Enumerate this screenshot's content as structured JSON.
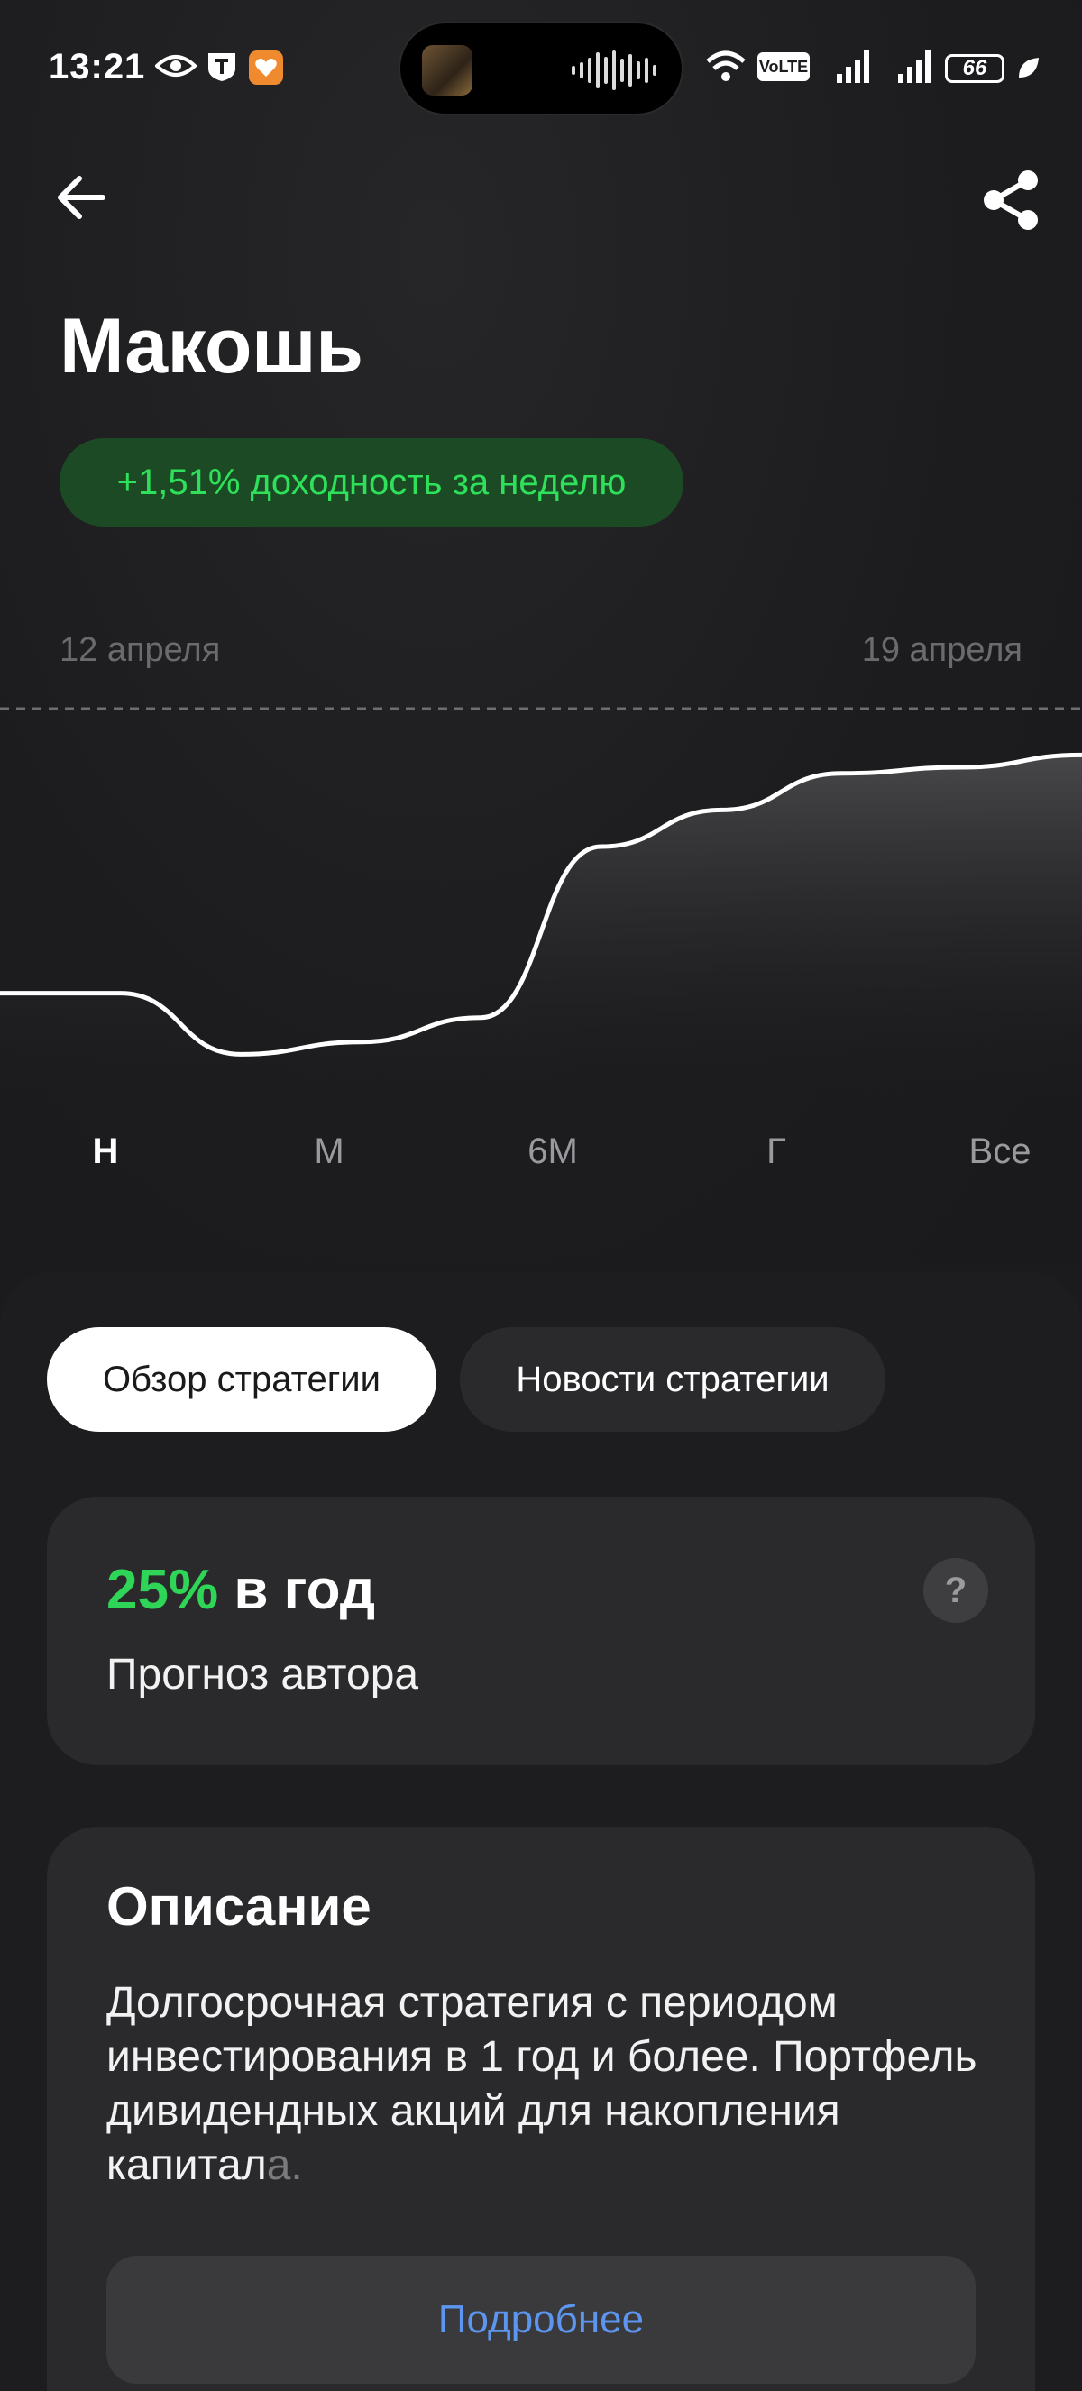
{
  "status_bar": {
    "time": "13:21",
    "battery": "66"
  },
  "header": {
    "title": "Макошь",
    "yield_badge": "+1,51% доходность за неделю"
  },
  "chart_data": {
    "type": "area",
    "x_labels": [
      "12 апреля",
      "19 апреля"
    ],
    "values": [
      0.0,
      0.0,
      -0.5,
      -0.4,
      -0.2,
      1.2,
      1.5,
      1.8,
      1.85,
      1.95
    ],
    "ylim": [
      -0.8,
      2.3
    ],
    "reference_line": "dashed",
    "grid": false
  },
  "periods": [
    "Н",
    "М",
    "6М",
    "Г",
    "Все"
  ],
  "active_period": "Н",
  "tabs": {
    "overview": "Обзор стратегии",
    "news": "Новости стратегии"
  },
  "forecast": {
    "value": "25%",
    "unit": " в год",
    "label": "Прогноз автора",
    "help": "?"
  },
  "description": {
    "title": "Описание",
    "text": "Долгосрочная стратегия с периодом инвестирования в 1 год и более. Портфель дивидендных акций для накопления капитал",
    "text_fade": "а.",
    "more_button": "Подробнее"
  },
  "colors": {
    "accent_green": "#2fd556",
    "badge_bg": "#1b4a25",
    "link_blue": "#5d96f0"
  }
}
